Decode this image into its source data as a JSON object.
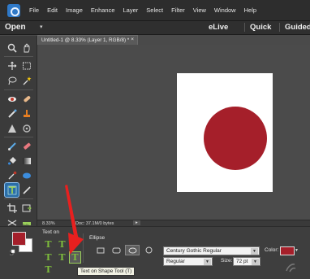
{
  "menu": {
    "items": [
      "File",
      "Edit",
      "Image",
      "Enhance",
      "Layer",
      "Select",
      "Filter",
      "View",
      "Window",
      "Help"
    ]
  },
  "modebar": {
    "open_label": "Open",
    "open_arrow": "▾",
    "elive_label": "eLive",
    "quick_label": "Quick",
    "guided_label": "Guided"
  },
  "document": {
    "tab_title": "Untitled-1 @ 8.33% (Layer 1, RGB/8) *",
    "tab_close": "×"
  },
  "status": {
    "zoom": "8.33%",
    "doc_size": "Doc: 37.1M/0 bytes",
    "arrow": "▸"
  },
  "options": {
    "text_on_label": "Text on",
    "ellipse_label": "Ellipse",
    "font_family": "Century Gothic Regular",
    "font_style": "Regular",
    "size_label": "Size:",
    "size_value": "72 pt",
    "color_label": "Color:",
    "tooltip": "Text on Shape Tool (T)"
  },
  "colors": {
    "accent_red": "#a51f2a",
    "active_tool_blue": "#2a6ea8",
    "text_tool_green": "#7dbb3c"
  },
  "icons": {
    "shape_tools": [
      "rectangle-icon",
      "rounded-rectangle-icon",
      "ellipse-icon",
      "polygon-icon"
    ]
  }
}
